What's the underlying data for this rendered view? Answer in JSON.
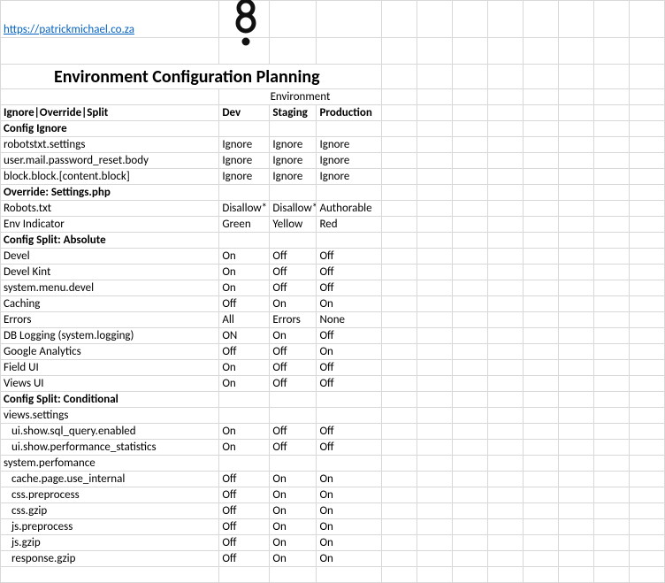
{
  "link_text": "https://patrickmichael.co.za",
  "link_href": "https://patrickmichael.co.za",
  "logo_name": "drupal-8-logo",
  "title": "Environment Configuration Planning",
  "env_header": "Environment",
  "column_header": "Ignore|Override|Split",
  "columns": {
    "dev": "Dev",
    "staging": "Staging",
    "production": "Production"
  },
  "sections": {
    "config_ignore": {
      "label": "Config Ignore",
      "rows": [
        {
          "label": "robotstxt.settings",
          "dev": "Ignore",
          "staging": "Ignore",
          "prod": "Ignore"
        },
        {
          "label": "user.mail.password_reset.body",
          "dev": "Ignore",
          "staging": "Ignore",
          "prod": "Ignore"
        },
        {
          "label": "block.block.[content.block]",
          "dev": "Ignore",
          "staging": "Ignore",
          "prod": "Ignore"
        }
      ]
    },
    "override_settings": {
      "label": "Override: Settings.php",
      "rows": [
        {
          "label": "Robots.txt",
          "dev": "Disallow*",
          "staging": "Disallow*",
          "prod": "Authorable"
        },
        {
          "label": "Env Indicator",
          "dev": "Green",
          "staging": "Yellow",
          "prod": "Red"
        }
      ]
    },
    "split_absolute": {
      "label": "Config Split: Absolute",
      "rows": [
        {
          "label": "Devel",
          "dev": "On",
          "staging": "Off",
          "prod": "Off"
        },
        {
          "label": "Devel Kint",
          "dev": "On",
          "staging": "Off",
          "prod": "Off"
        },
        {
          "label": "system.menu.devel",
          "dev": "On",
          "staging": "Off",
          "prod": "Off"
        },
        {
          "label": "Caching",
          "dev": "Off",
          "staging": "On",
          "prod": "On"
        },
        {
          "label": "Errors",
          "dev": "All",
          "staging": "Errors",
          "prod": "None"
        },
        {
          "label": "DB Logging (system.logging)",
          "dev": "ON",
          "staging": "On",
          "prod": "Off"
        },
        {
          "label": "Google Analytics",
          "dev": "Off",
          "staging": "Off",
          "prod": "On"
        },
        {
          "label": "Field UI",
          "dev": "On",
          "staging": "Off",
          "prod": "Off"
        },
        {
          "label": "Views UI",
          "dev": "On",
          "staging": "Off",
          "prod": "Off"
        }
      ]
    },
    "split_conditional": {
      "label": "Config Split: Conditional",
      "groups": [
        {
          "label": "views.settings",
          "rows": [
            {
              "label": "ui.show.sql_query.enabled",
              "dev": "On",
              "staging": "Off",
              "prod": "Off"
            },
            {
              "label": "ui.show.performance_statistics",
              "dev": "On",
              "staging": "Off",
              "prod": "Off"
            }
          ]
        },
        {
          "label": "system.perfomance",
          "rows": [
            {
              "label": "cache.page.use_internal",
              "dev": "Off",
              "staging": "On",
              "prod": "On"
            },
            {
              "label": "css.preprocess",
              "dev": "Off",
              "staging": "On",
              "prod": "On"
            },
            {
              "label": "css.gzip",
              "dev": "Off",
              "staging": "On",
              "prod": "On"
            },
            {
              "label": "js.preprocess",
              "dev": "Off",
              "staging": "On",
              "prod": "On"
            },
            {
              "label": "js.gzip",
              "dev": "Off",
              "staging": "On",
              "prod": "On"
            },
            {
              "label": "response.gzip",
              "dev": "Off",
              "staging": "On",
              "prod": "On"
            }
          ]
        }
      ]
    }
  }
}
